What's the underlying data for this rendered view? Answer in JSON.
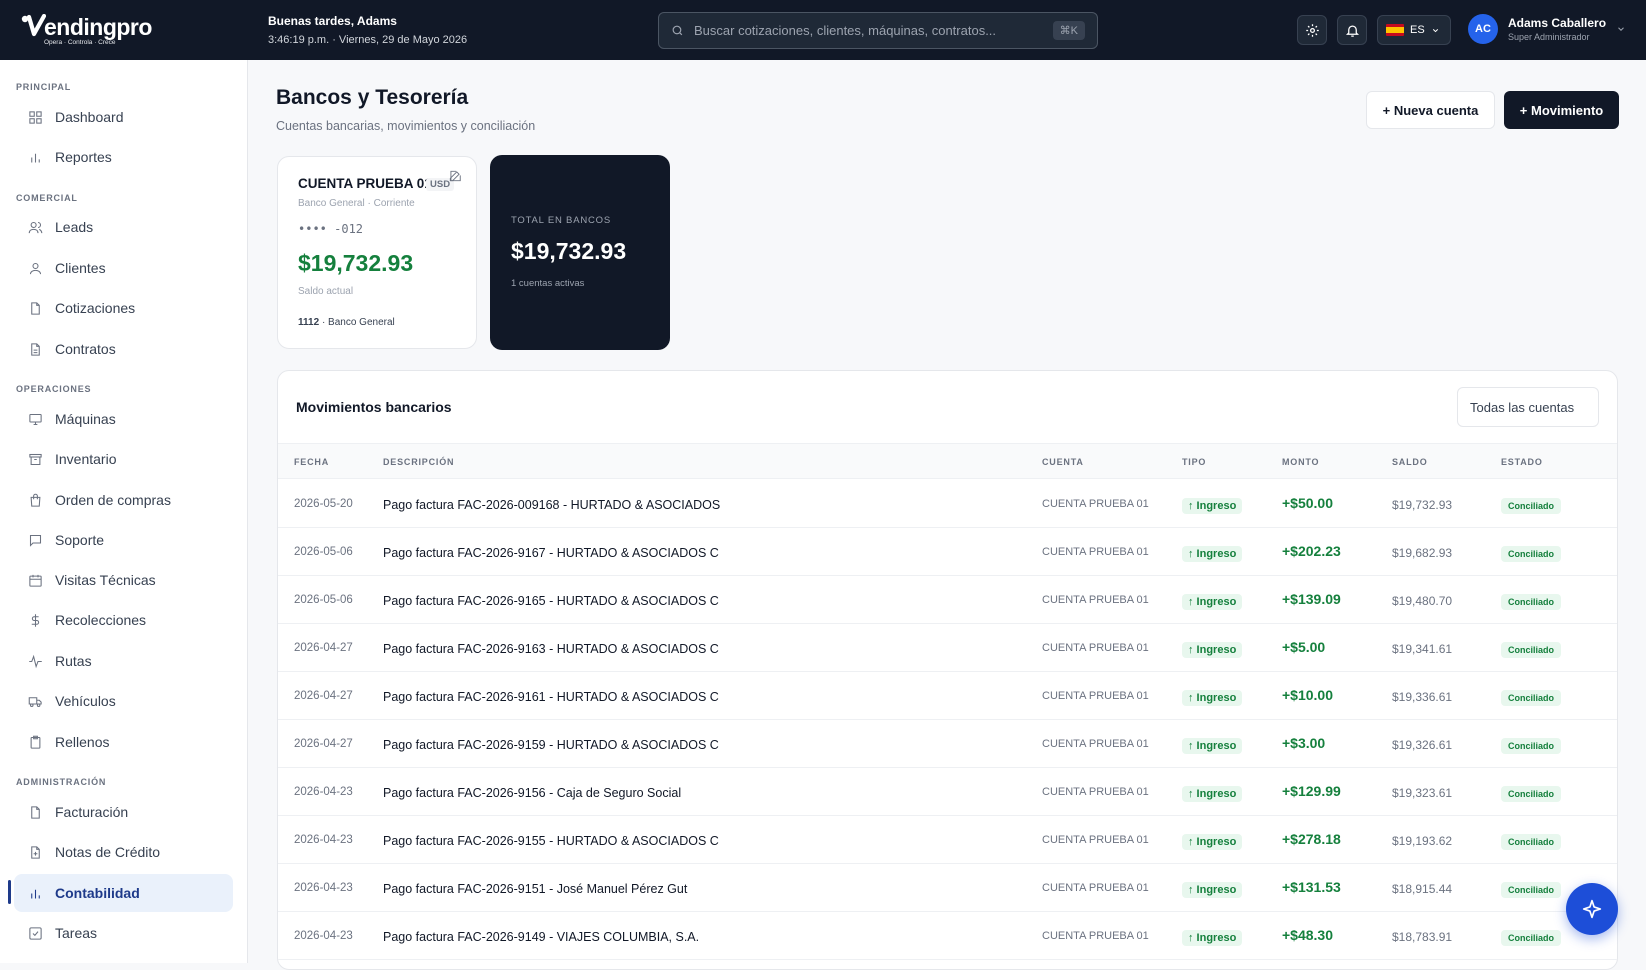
{
  "header": {
    "logo_text": "endingpro",
    "logo_tagline": "Opera · Controla · Crece",
    "greeting": "Buenas tardes, Adams",
    "datetime": "3:46:19 p.m. · Viernes, 29 de Mayo 2026",
    "search_placeholder": "Buscar cotizaciones, clientes, máquinas, contratos...",
    "search_shortcut": "⌘K",
    "language": "ES",
    "user_initials": "AC",
    "user_name": "Adams Caballero",
    "user_role": "Super Administrador"
  },
  "sidebar": {
    "sections": [
      {
        "label": "PRINCIPAL",
        "items": [
          {
            "label": "Dashboard",
            "icon": "grid-icon"
          },
          {
            "label": "Reportes",
            "icon": "bar-chart-icon"
          }
        ]
      },
      {
        "label": "COMERCIAL",
        "items": [
          {
            "label": "Leads",
            "icon": "users-icon"
          },
          {
            "label": "Clientes",
            "icon": "user-icon"
          },
          {
            "label": "Cotizaciones",
            "icon": "file-icon"
          },
          {
            "label": "Contratos",
            "icon": "file-text-icon"
          }
        ]
      },
      {
        "label": "OPERACIONES",
        "items": [
          {
            "label": "Máquinas",
            "icon": "monitor-icon"
          },
          {
            "label": "Inventario",
            "icon": "archive-icon"
          },
          {
            "label": "Orden de compras",
            "icon": "shopping-bag-icon"
          },
          {
            "label": "Soporte",
            "icon": "message-icon"
          },
          {
            "label": "Visitas Técnicas",
            "icon": "calendar-icon"
          },
          {
            "label": "Recolecciones",
            "icon": "dollar-icon"
          },
          {
            "label": "Rutas",
            "icon": "activity-icon"
          },
          {
            "label": "Vehículos",
            "icon": "truck-icon"
          },
          {
            "label": "Rellenos",
            "icon": "clipboard-icon"
          }
        ]
      },
      {
        "label": "ADMINISTRACIÓN",
        "items": [
          {
            "label": "Facturación",
            "icon": "file-icon"
          },
          {
            "label": "Notas de Crédito",
            "icon": "file-plus-icon"
          },
          {
            "label": "Contabilidad",
            "icon": "bar-chart-icon",
            "active": true
          },
          {
            "label": "Tareas",
            "icon": "check-square-icon"
          }
        ]
      }
    ]
  },
  "page": {
    "title": "Bancos y Tesorería",
    "subtitle": "Cuentas bancarias, movimientos y conciliación",
    "new_account_label": "+ Nueva cuenta",
    "new_movement_label": "+ Movimiento"
  },
  "account_card": {
    "name": "CUENTA PRUEBA 01",
    "currency": "USD",
    "bank_type": "Banco General · Corriente",
    "masked_number": "•••• -012",
    "balance": "$19,732.93",
    "balance_label": "Saldo actual",
    "footer_code": "1112",
    "footer_bank": "· Banco General"
  },
  "total_card": {
    "label": "TOTAL EN BANCOS",
    "value": "$19,732.93",
    "sub": "1 cuentas activas"
  },
  "movements": {
    "title": "Movimientos bancarios",
    "filter_value": "Todas las cuentas",
    "columns": [
      "FECHA",
      "DESCRIPCIÓN",
      "CUENTA",
      "TIPO",
      "MONTO",
      "SALDO",
      "ESTADO"
    ],
    "rows": [
      {
        "fecha": "2026-05-20",
        "descripcion": "Pago factura FAC-2026-009168 - HURTADO & ASOCIADOS",
        "cuenta": "CUENTA PRUEBA 01",
        "tipo": "↑ Ingreso",
        "monto": "+$50.00",
        "saldo": "$19,732.93",
        "estado": "Conciliado"
      },
      {
        "fecha": "2026-05-06",
        "descripcion": "Pago factura FAC-2026-9167 - HURTADO & ASOCIADOS C",
        "cuenta": "CUENTA PRUEBA 01",
        "tipo": "↑ Ingreso",
        "monto": "+$202.23",
        "saldo": "$19,682.93",
        "estado": "Conciliado"
      },
      {
        "fecha": "2026-05-06",
        "descripcion": "Pago factura FAC-2026-9165 - HURTADO & ASOCIADOS C",
        "cuenta": "CUENTA PRUEBA 01",
        "tipo": "↑ Ingreso",
        "monto": "+$139.09",
        "saldo": "$19,480.70",
        "estado": "Conciliado"
      },
      {
        "fecha": "2026-04-27",
        "descripcion": "Pago factura FAC-2026-9163 - HURTADO & ASOCIADOS C",
        "cuenta": "CUENTA PRUEBA 01",
        "tipo": "↑ Ingreso",
        "monto": "+$5.00",
        "saldo": "$19,341.61",
        "estado": "Conciliado"
      },
      {
        "fecha": "2026-04-27",
        "descripcion": "Pago factura FAC-2026-9161 - HURTADO & ASOCIADOS C",
        "cuenta": "CUENTA PRUEBA 01",
        "tipo": "↑ Ingreso",
        "monto": "+$10.00",
        "saldo": "$19,336.61",
        "estado": "Conciliado"
      },
      {
        "fecha": "2026-04-27",
        "descripcion": "Pago factura FAC-2026-9159 - HURTADO & ASOCIADOS C",
        "cuenta": "CUENTA PRUEBA 01",
        "tipo": "↑ Ingreso",
        "monto": "+$3.00",
        "saldo": "$19,326.61",
        "estado": "Conciliado"
      },
      {
        "fecha": "2026-04-23",
        "descripcion": "Pago factura FAC-2026-9156 - Caja de Seguro Social",
        "cuenta": "CUENTA PRUEBA 01",
        "tipo": "↑ Ingreso",
        "monto": "+$129.99",
        "saldo": "$19,323.61",
        "estado": "Conciliado"
      },
      {
        "fecha": "2026-04-23",
        "descripcion": "Pago factura FAC-2026-9155 - HURTADO & ASOCIADOS C",
        "cuenta": "CUENTA PRUEBA 01",
        "tipo": "↑ Ingreso",
        "monto": "+$278.18",
        "saldo": "$19,193.62",
        "estado": "Conciliado"
      },
      {
        "fecha": "2026-04-23",
        "descripcion": "Pago factura FAC-2026-9151 - José Manuel Pérez Gut",
        "cuenta": "CUENTA PRUEBA 01",
        "tipo": "↑ Ingreso",
        "monto": "+$131.53",
        "saldo": "$18,915.44",
        "estado": "Conciliado"
      },
      {
        "fecha": "2026-04-23",
        "descripcion": "Pago factura FAC-2026-9149 - VIAJES COLUMBIA, S.A.",
        "cuenta": "CUENTA PRUEBA 01",
        "tipo": "↑ Ingreso",
        "monto": "+$48.30",
        "saldo": "$18,783.91",
        "estado": "Conciliado"
      }
    ]
  },
  "colors": {
    "topbar": "#111827",
    "accent": "#1e3a8a",
    "positive": "#15803d",
    "fab": "#1d4ed8"
  }
}
